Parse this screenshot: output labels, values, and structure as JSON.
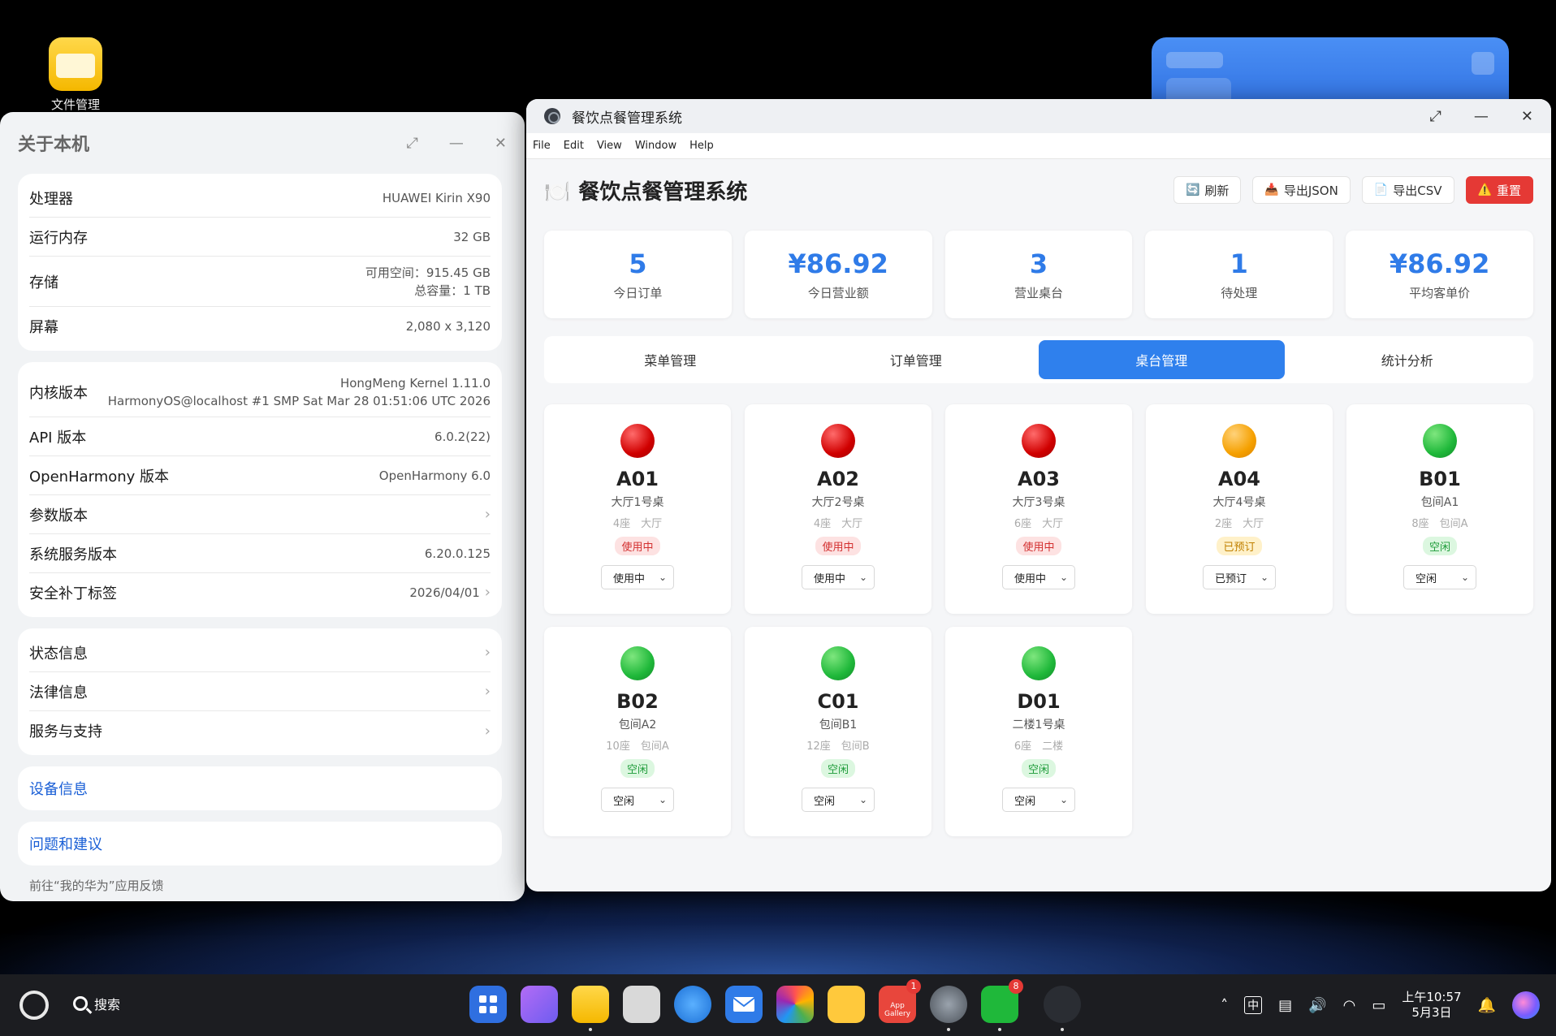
{
  "desktop": {
    "file_manager_label": "文件管理"
  },
  "about": {
    "title": "关于本机",
    "hw": [
      {
        "k": "处理器",
        "v": "HUAWEI Kirin X90"
      },
      {
        "k": "运行内存",
        "v": "32 GB"
      },
      {
        "k": "存储",
        "v1": "可用空间：915.45 GB",
        "v2": "总容量：1 TB"
      },
      {
        "k": "屏幕",
        "v": "2,080 x 3,120"
      }
    ],
    "sw": {
      "kernel_k": "内核版本",
      "kernel_v1": "HongMeng Kernel 1.11.0",
      "kernel_v2": "HarmonyOS@localhost #1 SMP Sat Mar 28 01:51:06 UTC 2026",
      "api_k": "API 版本",
      "api_v": "6.0.2(22)",
      "oh_k": "OpenHarmony 版本",
      "oh_v": "OpenHarmony 6.0",
      "param_k": "参数版本",
      "svc_k": "系统服务版本",
      "svc_v": "6.20.0.125",
      "patch_k": "安全补丁标签",
      "patch_v": "2026/04/01"
    },
    "info": [
      "状态信息",
      "法律信息",
      "服务与支持"
    ],
    "device_info": "设备信息",
    "feedback_link": "问题和建议",
    "feedback_note": "前往“我的华为”应用反馈"
  },
  "main": {
    "window_title": "餐饮点餐管理系统",
    "menu": [
      "File",
      "Edit",
      "View",
      "Window",
      "Help"
    ],
    "header_icon": "🍽️",
    "header_title": "餐饮点餐管理系统",
    "buttons": {
      "refresh": "刷新",
      "export_json": "导出JSON",
      "export_csv": "导出CSV",
      "reset": "重置"
    },
    "stats": [
      {
        "n": "5",
        "l": "今日订单"
      },
      {
        "n": "¥86.92",
        "l": "今日营业额"
      },
      {
        "n": "3",
        "l": "营业桌台"
      },
      {
        "n": "1",
        "l": "待处理"
      },
      {
        "n": "¥86.92",
        "l": "平均客单价"
      }
    ],
    "tabs": [
      "菜单管理",
      "订单管理",
      "桌台管理",
      "统计分析"
    ],
    "active_tab": "桌台管理",
    "tables": [
      {
        "code": "A01",
        "name": "大厅1号桌",
        "meta": "4座　大厅",
        "status": "使用中",
        "select": "使用中",
        "color": "red"
      },
      {
        "code": "A02",
        "name": "大厅2号桌",
        "meta": "4座　大厅",
        "status": "使用中",
        "select": "使用中",
        "color": "red"
      },
      {
        "code": "A03",
        "name": "大厅3号桌",
        "meta": "6座　大厅",
        "status": "使用中",
        "select": "使用中",
        "color": "red"
      },
      {
        "code": "A04",
        "name": "大厅4号桌",
        "meta": "2座　大厅",
        "status": "已预订",
        "select": "已预订",
        "color": "orange"
      },
      {
        "code": "B01",
        "name": "包间A1",
        "meta": "8座　包间A",
        "status": "空闲",
        "select": "空闲",
        "color": "green"
      },
      {
        "code": "B02",
        "name": "包间A2",
        "meta": "10座　包间A",
        "status": "空闲",
        "select": "空闲",
        "color": "green"
      },
      {
        "code": "C01",
        "name": "包间B1",
        "meta": "12座　包间B",
        "status": "空闲",
        "select": "空闲",
        "color": "green"
      },
      {
        "code": "D01",
        "name": "二楼1号桌",
        "meta": "6座　二楼",
        "status": "空闲",
        "select": "空闲",
        "color": "green"
      }
    ]
  },
  "taskbar": {
    "search_label": "搜索",
    "ime": "中",
    "time": "上午10:57",
    "date": "5月3日",
    "app_gallery_badge": "1",
    "wechat_badge": "8",
    "app_gallery_text": "App Gallery"
  }
}
